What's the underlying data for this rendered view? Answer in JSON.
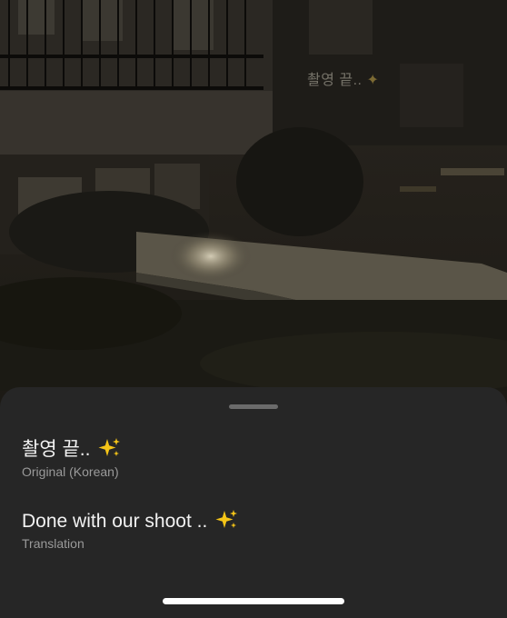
{
  "story": {
    "caption_text": "촬영 끝..",
    "caption_emoji": "sparkles-emoji"
  },
  "translation_sheet": {
    "original": {
      "text": "촬영 끝..",
      "emoji": "sparkles-emoji",
      "label": "Original (Korean)"
    },
    "translated": {
      "text": "Done with our shoot ..",
      "emoji": "sparkles-emoji",
      "label": "Translation"
    }
  },
  "colors": {
    "sheet_background": "#262626",
    "primary_text": "#f2f2f2",
    "secondary_text": "#9a9a9a",
    "sparkle": "#f5c518"
  }
}
